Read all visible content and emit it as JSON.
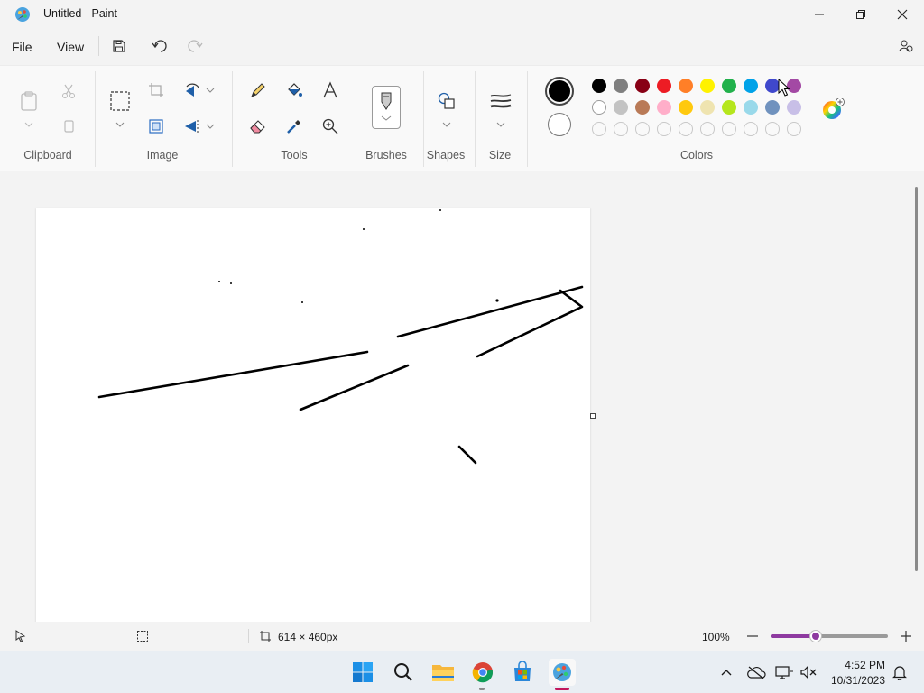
{
  "window": {
    "title": "Untitled - Paint"
  },
  "menu": {
    "file": "File",
    "view": "View"
  },
  "ribbon": {
    "groups": {
      "clipboard": "Clipboard",
      "image": "Image",
      "tools": "Tools",
      "brushes": "Brushes",
      "shapes": "Shapes",
      "size": "Size",
      "colors": "Colors"
    }
  },
  "colors": {
    "primary": "#000000",
    "secondary": "#ffffff",
    "row1": [
      "#000000",
      "#7f7f7f",
      "#880015",
      "#ed1c24",
      "#ff7f27",
      "#fff200",
      "#22b14c",
      "#00a2e8",
      "#3f48cc",
      "#a349a4"
    ],
    "row2": [
      "#ffffff",
      "#c3c3c3",
      "#b97a57",
      "#ffaec9",
      "#ffc90e",
      "#efe4b0",
      "#b5e61d",
      "#99d9ea",
      "#7092be",
      "#c8bfe7"
    ],
    "row3": [
      "empty",
      "empty",
      "empty",
      "empty",
      "empty",
      "empty",
      "empty",
      "empty",
      "empty",
      "empty"
    ]
  },
  "status": {
    "canvas_size": "614 × 460px",
    "zoom": "100%",
    "zoom_level": 0.5
  },
  "taskbar": {
    "time": "4:52 PM",
    "date": "10/31/2023"
  }
}
